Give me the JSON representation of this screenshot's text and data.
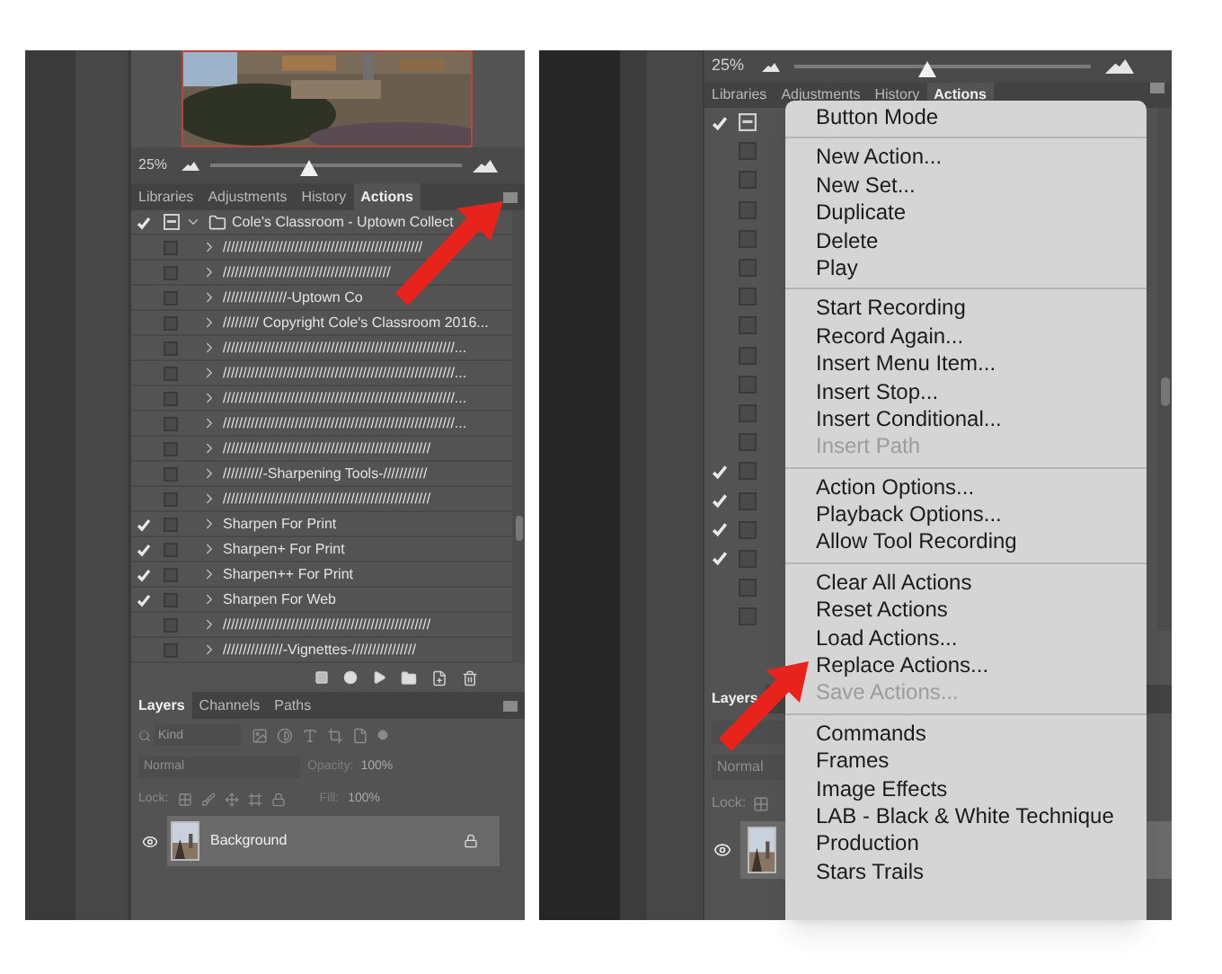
{
  "left_screenshot": {
    "navigator": {
      "zoom": "25%",
      "level": 0.39
    },
    "panel_tabs": [
      {
        "label": "Libraries",
        "selected": false
      },
      {
        "label": "Adjustments",
        "selected": false
      },
      {
        "label": "History",
        "selected": false
      },
      {
        "label": "Actions",
        "selected": true
      }
    ],
    "actions": [
      {
        "kind": "set",
        "label": "Cole's Classroom - Uptown Collect",
        "checked": true
      },
      {
        "kind": "action",
        "label": "//////////////////////////////////////////////////",
        "checked": false
      },
      {
        "kind": "action",
        "label": "//////////////////////////////////////////",
        "checked": false
      },
      {
        "kind": "action",
        "label": "////////////////-Uptown Co",
        "checked": false
      },
      {
        "kind": "action",
        "label": "///////// Copyright Cole's Classroom 2016...",
        "checked": false
      },
      {
        "kind": "action",
        "label": "//////////////////////////////////////////////////////////...",
        "checked": false
      },
      {
        "kind": "action",
        "label": "//////////////////////////////////////////////////////////...",
        "checked": false
      },
      {
        "kind": "action",
        "label": "//////////////////////////////////////////////////////////...",
        "checked": false
      },
      {
        "kind": "action",
        "label": "//////////////////////////////////////////////////////////...",
        "checked": false
      },
      {
        "kind": "action",
        "label": "////////////////////////////////////////////////////",
        "checked": false
      },
      {
        "kind": "action",
        "label": "//////////-Sharpening Tools-///////////",
        "checked": false
      },
      {
        "kind": "action",
        "label": "////////////////////////////////////////////////////",
        "checked": false
      },
      {
        "kind": "action",
        "label": "Sharpen For Print",
        "checked": true
      },
      {
        "kind": "action",
        "label": "Sharpen+ For Print",
        "checked": true
      },
      {
        "kind": "action",
        "label": "Sharpen++ For Print",
        "checked": true
      },
      {
        "kind": "action",
        "label": "Sharpen For Web",
        "checked": true
      },
      {
        "kind": "action",
        "label": "////////////////////////////////////////////////////",
        "checked": false
      },
      {
        "kind": "action",
        "label": "///////////////-Vignettes-////////////////",
        "checked": false
      }
    ],
    "layers_tabs": [
      {
        "label": "Layers",
        "selected": true
      },
      {
        "label": "Channels",
        "selected": false
      },
      {
        "label": "Paths",
        "selected": false
      }
    ],
    "filter": {
      "placeholder": "Kind"
    },
    "blend_mode": "Normal",
    "opacity_label": "Opacity:",
    "opacity": "100%",
    "lock_label": "Lock:",
    "fill_label": "Fill:",
    "fill": "100%",
    "layers": [
      {
        "name": "Background",
        "visible": true,
        "locked": true
      }
    ]
  },
  "right_screenshot": {
    "navigator": {
      "zoom": "25%",
      "level": 0.45
    },
    "panel_tabs": [
      {
        "label": "Libraries",
        "selected": false
      },
      {
        "label": "Adjustments",
        "selected": false
      },
      {
        "label": "History",
        "selected": false
      },
      {
        "label": "Actions",
        "selected": true
      }
    ],
    "action_rows": [
      {
        "kind": "set",
        "checked": true
      },
      {
        "kind": "action",
        "checked": false
      },
      {
        "kind": "action",
        "checked": false
      },
      {
        "kind": "action",
        "checked": false
      },
      {
        "kind": "action",
        "checked": false
      },
      {
        "kind": "action",
        "checked": false
      },
      {
        "kind": "action",
        "checked": false
      },
      {
        "kind": "action",
        "checked": false
      },
      {
        "kind": "action",
        "checked": false
      },
      {
        "kind": "action",
        "checked": false
      },
      {
        "kind": "action",
        "checked": false
      },
      {
        "kind": "action",
        "checked": false
      },
      {
        "kind": "action",
        "checked": true
      },
      {
        "kind": "action",
        "checked": true
      },
      {
        "kind": "action",
        "checked": true
      },
      {
        "kind": "action",
        "checked": true
      },
      {
        "kind": "action",
        "checked": false
      },
      {
        "kind": "action",
        "checked": false
      }
    ],
    "layers_tabs": [
      {
        "label": "Layers",
        "selected": true
      }
    ],
    "blend_mode": "Normal",
    "lock_label": "Lock:",
    "layers": [
      {
        "visible": true
      }
    ],
    "menu": {
      "groups": [
        {
          "items": [
            {
              "label": "Button Mode",
              "disabled": false
            }
          ]
        },
        {
          "items": [
            {
              "label": "New Action...",
              "disabled": false
            },
            {
              "label": "New Set...",
              "disabled": false
            },
            {
              "label": "Duplicate",
              "disabled": false
            },
            {
              "label": "Delete",
              "disabled": false
            },
            {
              "label": "Play",
              "disabled": false
            }
          ]
        },
        {
          "items": [
            {
              "label": "Start Recording",
              "disabled": false
            },
            {
              "label": "Record Again...",
              "disabled": false
            },
            {
              "label": "Insert Menu Item...",
              "disabled": false
            },
            {
              "label": "Insert Stop...",
              "disabled": false
            },
            {
              "label": "Insert Conditional...",
              "disabled": false
            },
            {
              "label": "Insert Path",
              "disabled": true
            }
          ]
        },
        {
          "items": [
            {
              "label": "Action Options...",
              "disabled": false
            },
            {
              "label": "Playback Options...",
              "disabled": false
            },
            {
              "label": "Allow Tool Recording",
              "disabled": false
            }
          ]
        },
        {
          "items": [
            {
              "label": "Clear All Actions",
              "disabled": false
            },
            {
              "label": "Reset Actions",
              "disabled": false
            },
            {
              "label": "Load Actions...",
              "disabled": false
            },
            {
              "label": "Replace Actions...",
              "disabled": false
            },
            {
              "label": "Save Actions...",
              "disabled": true
            }
          ]
        },
        {
          "items": [
            {
              "label": "Commands",
              "disabled": false
            },
            {
              "label": "Frames",
              "disabled": false
            },
            {
              "label": "Image Effects",
              "disabled": false
            },
            {
              "label": "LAB - Black & White Technique",
              "disabled": false
            },
            {
              "label": "Production",
              "disabled": false
            },
            {
              "label": "Stars Trails",
              "disabled": false
            }
          ]
        }
      ]
    }
  }
}
